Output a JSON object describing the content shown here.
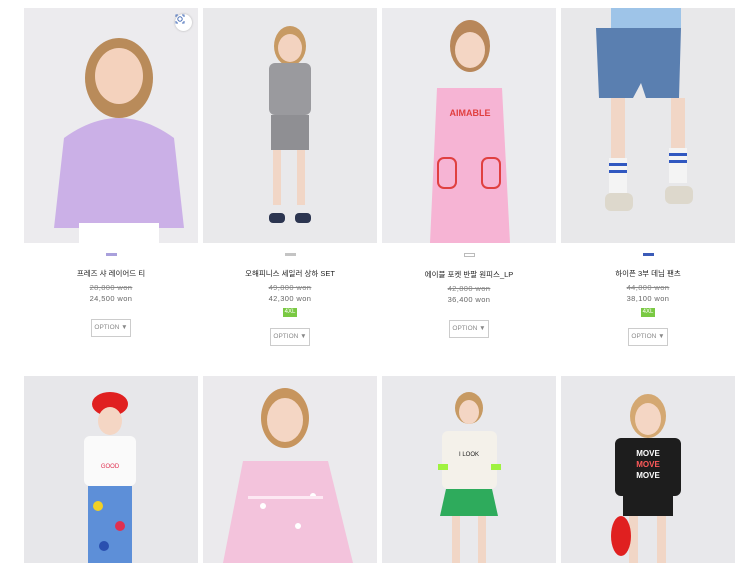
{
  "products": [
    {
      "name": "프레즈 샤 레이어드 티",
      "original_price": "28,800 won",
      "sale_price": "24,500 won",
      "badge": "",
      "option_label": "OPTION ▼",
      "swatch_color": "#a9a0dc",
      "bg": "#ecebee",
      "outfit": "#c8aae6",
      "icon": "lens-search-icon"
    },
    {
      "name": "오해피니스 세일러 상하 SET",
      "original_price": "49,800 won",
      "sale_price": "42,300 won",
      "badge": "4XL",
      "option_label": "OPTION ▼",
      "swatch_color": "#c4c4c4",
      "bg": "#e9e9eb",
      "outfit": "#9a9a9e"
    },
    {
      "name": "에이블 포켓 반팔 원피스_LP",
      "original_price": "42,800 won",
      "sale_price": "36,400 won",
      "badge": "",
      "option_label": "OPTION ▼",
      "swatch_color": "#ffffff",
      "bg": "#ebebee",
      "outfit": "#f6b4d4"
    },
    {
      "name": "하이픈 3부 데님 팬츠",
      "original_price": "44,800 won",
      "sale_price": "38,100 won",
      "badge": "4XL",
      "option_label": "OPTION ▼",
      "swatch_color": "#3b5bb8",
      "bg": "#e8e8ea",
      "outfit": "#5a7fb0"
    },
    {
      "name": "",
      "original_price": "",
      "sale_price": "",
      "badge": "",
      "option_label": "",
      "swatch_color": "",
      "bg": "#e7e7ea",
      "outfit": "#5d8fd8"
    },
    {
      "name": "",
      "original_price": "",
      "sale_price": "",
      "badge": "",
      "option_label": "",
      "swatch_color": "",
      "bg": "#ebeaed",
      "outfit": "#f3c3dc"
    },
    {
      "name": "",
      "original_price": "",
      "sale_price": "",
      "badge": "",
      "option_label": "",
      "swatch_color": "",
      "bg": "#e9e9ec",
      "outfit": "#2eab5c"
    },
    {
      "name": "",
      "original_price": "",
      "sale_price": "",
      "badge": "",
      "option_label": "",
      "swatch_color": "",
      "bg": "#e8e8eb",
      "outfit": "#1d1d1d"
    }
  ]
}
